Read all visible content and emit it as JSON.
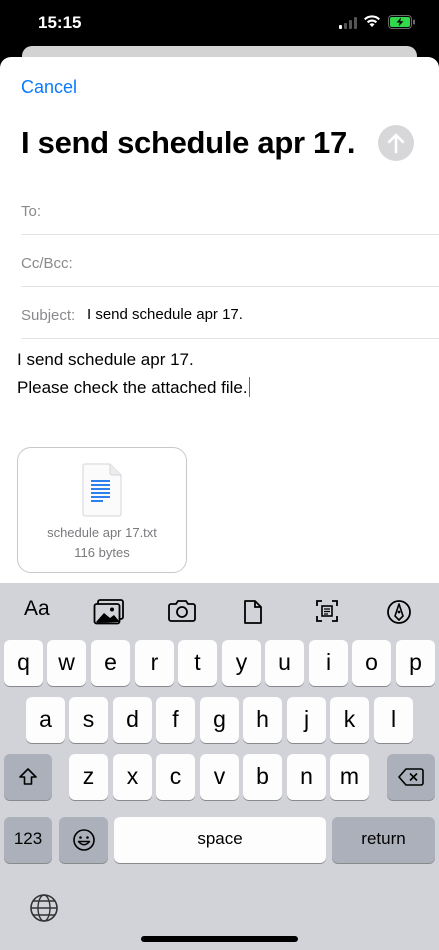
{
  "status_bar": {
    "time": "15:15"
  },
  "compose": {
    "cancel_label": "Cancel",
    "title": "I send schedule apr 17.",
    "to_label": "To:",
    "cc_label": "Cc/Bcc:",
    "subject_label": "Subject:",
    "subject_value": "I send schedule apr 17.",
    "body_line1": "I send schedule apr 17.",
    "body_line2": "Please check the attached file."
  },
  "attachment": {
    "file_name": "schedule apr 17.txt",
    "file_size": "116 bytes"
  },
  "keyboard": {
    "format_label": "Aa",
    "toolbar_icons": [
      "photo-library-icon",
      "camera-icon",
      "document-icon",
      "scan-document-icon",
      "markup-icon"
    ],
    "row1": [
      "q",
      "w",
      "e",
      "r",
      "t",
      "y",
      "u",
      "i",
      "o",
      "p"
    ],
    "row2": [
      "a",
      "s",
      "d",
      "f",
      "g",
      "h",
      "j",
      "k",
      "l"
    ],
    "row3": [
      "z",
      "x",
      "c",
      "v",
      "b",
      "n",
      "m"
    ],
    "numbers_label": "123",
    "space_label": "space",
    "return_label": "return"
  },
  "colors": {
    "accent": "#0a7aff",
    "keyboard_bg": "#d1d3d9",
    "key_bg": "#fdfdfe",
    "modifier_key_bg": "#abb0bb"
  }
}
